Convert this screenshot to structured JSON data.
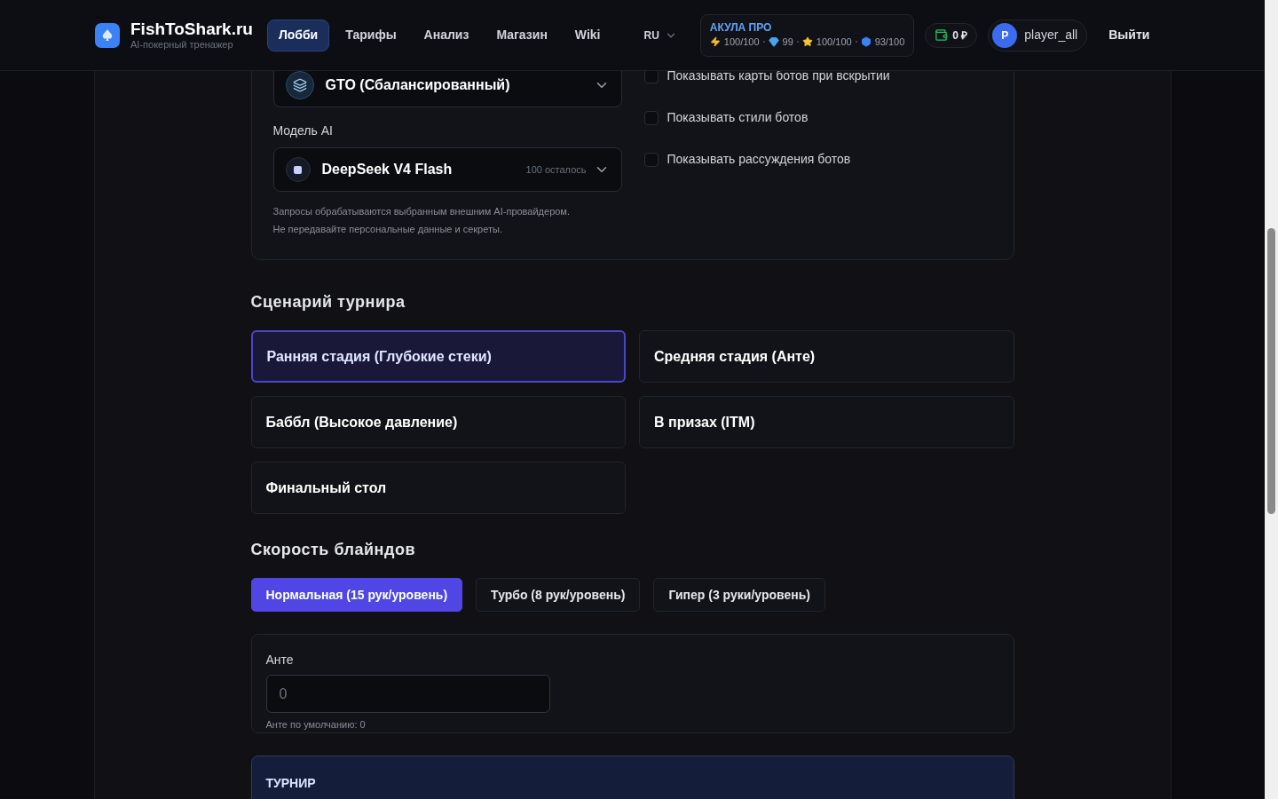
{
  "header": {
    "brand": "FishToShark.ru",
    "tagline": "AI-покерный тренажер",
    "nav": [
      {
        "label": "Лобби",
        "selected": true
      },
      {
        "label": "Тарифы",
        "selected": false
      },
      {
        "label": "Анализ",
        "selected": false
      },
      {
        "label": "Магазин",
        "selected": false
      },
      {
        "label": "Wiki",
        "selected": false
      }
    ],
    "language": "RU",
    "plan": {
      "name": "АКУЛА ПРО",
      "stats": [
        {
          "kind": "bolt",
          "value": "100/100"
        },
        {
          "kind": "gem",
          "value": "99"
        },
        {
          "kind": "star",
          "value": "100/100"
        },
        {
          "kind": "cube",
          "value": "93/100"
        }
      ]
    },
    "balance": "0 ₽",
    "user": {
      "initial": "P",
      "name": "player_all"
    },
    "logout": "Выйти"
  },
  "settings": {
    "style_select": {
      "value": "GTO (Сбалансированный)"
    },
    "model_label": "Модель AI",
    "model_select": {
      "value": "DeepSeek V4 Flash",
      "remaining": "100 осталось"
    },
    "note": [
      "Запросы обрабатываются выбранным внешним AI-провайдером.",
      "Не передавайте персональные данные и секреты."
    ],
    "options": [
      {
        "label": "Показывать карты ботов при вскрытии",
        "checked": false
      },
      {
        "label": "Показывать стили ботов",
        "checked": false
      },
      {
        "label": "Показывать рассуждения ботов",
        "checked": false
      }
    ]
  },
  "scenario": {
    "title": "Сценарий турнира",
    "items": [
      {
        "label": "Ранняя стадия (Глубокие стеки)",
        "selected": true
      },
      {
        "label": "Средняя стадия (Анте)",
        "selected": false
      },
      {
        "label": "Баббл (Высокое давление)",
        "selected": false
      },
      {
        "label": "В призах (ITM)",
        "selected": false
      },
      {
        "label": "Финальный стол",
        "selected": false
      }
    ]
  },
  "blinds": {
    "title": "Скорость блайндов",
    "items": [
      {
        "label": "Нормальная (15 рук/уровень)",
        "selected": true
      },
      {
        "label": "Турбо (8 рук/уровень)",
        "selected": false
      },
      {
        "label": "Гипер (3 руки/уровень)",
        "selected": false
      }
    ]
  },
  "ante": {
    "label": "Анте",
    "placeholder": "0",
    "hint": "Анте по умолчанию: 0"
  },
  "tournament": {
    "title": "ТУРНИР"
  }
}
